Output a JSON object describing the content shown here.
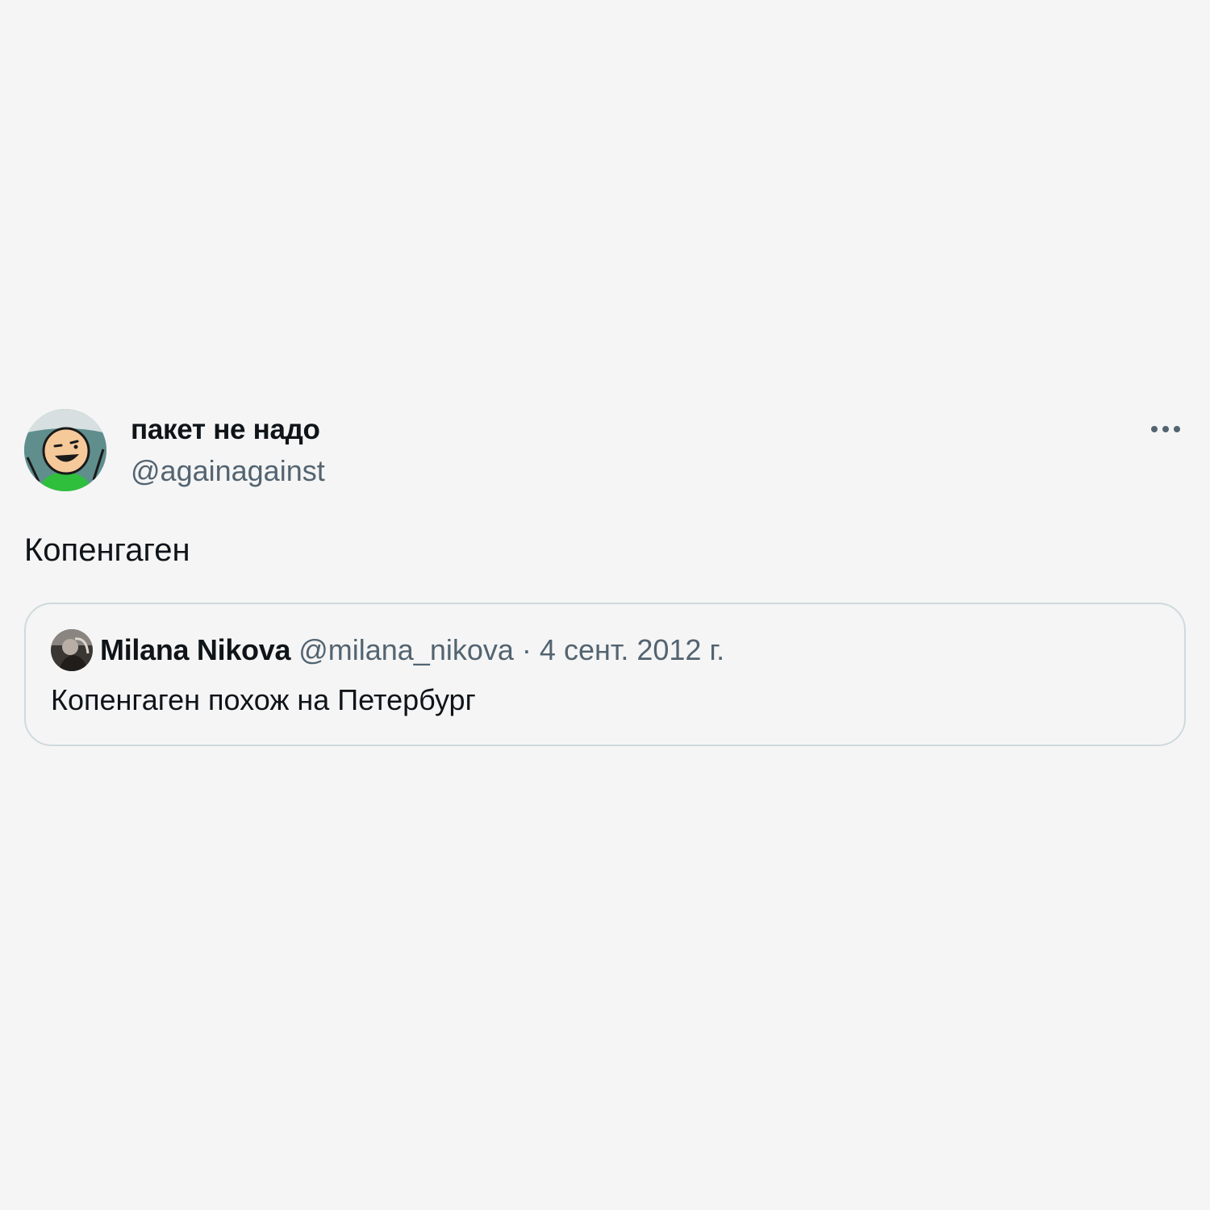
{
  "tweet": {
    "author": {
      "name": "пакет не надо",
      "handle": "@againagainst",
      "avatar_icon": "cartoon-face-avatar"
    },
    "more_icon": "more-horizontal-icon",
    "text": "Копенгаген",
    "quoted_tweet": {
      "author": {
        "name": "Milana Nikova",
        "handle": "@milana_nikova",
        "avatar_icon": "photo-avatar"
      },
      "separator": "·",
      "date": "4 сент. 2012 г.",
      "text": "Копенгаген похож на Петербург"
    }
  },
  "colors": {
    "background": "#f5f5f5",
    "text_primary": "#0f1419",
    "text_secondary": "#536471",
    "border": "#cfd9de",
    "avatar_bg": "#5b8c8c",
    "avatar_shirt": "#3dbb3d"
  }
}
